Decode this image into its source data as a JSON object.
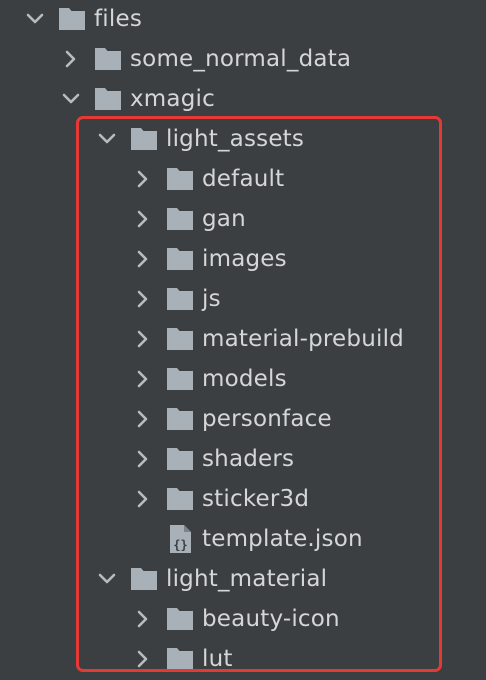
{
  "colors": {
    "background": "#3c3f41",
    "text": "#d4d6d8",
    "folder_icon": "#a9b1b8",
    "chevron": "#b6bcc2",
    "highlight_border": "#e53935"
  },
  "tree": {
    "files": {
      "label": "files",
      "expanded": true,
      "icon": "folder-icon"
    },
    "some_normal_data": {
      "label": "some_normal_data",
      "expanded": false,
      "icon": "folder-icon"
    },
    "xmagic": {
      "label": "xmagic",
      "expanded": true,
      "icon": "folder-icon"
    },
    "light_assets": {
      "label": "light_assets",
      "expanded": true,
      "icon": "folder-icon",
      "children": [
        {
          "label": "default",
          "icon": "folder-icon"
        },
        {
          "label": "gan",
          "icon": "folder-icon"
        },
        {
          "label": "images",
          "icon": "folder-icon"
        },
        {
          "label": "js",
          "icon": "folder-icon"
        },
        {
          "label": "material-prebuild",
          "icon": "folder-icon"
        },
        {
          "label": "models",
          "icon": "folder-icon"
        },
        {
          "label": "personface",
          "icon": "folder-icon"
        },
        {
          "label": "shaders",
          "icon": "folder-icon"
        },
        {
          "label": "sticker3d",
          "icon": "folder-icon"
        },
        {
          "label": "template.json",
          "icon": "json-file-icon"
        }
      ]
    },
    "light_material": {
      "label": "light_material",
      "expanded": true,
      "icon": "folder-icon",
      "children": [
        {
          "label": "beauty-icon",
          "icon": "folder-icon"
        },
        {
          "label": "lut",
          "icon": "folder-icon"
        }
      ]
    }
  }
}
